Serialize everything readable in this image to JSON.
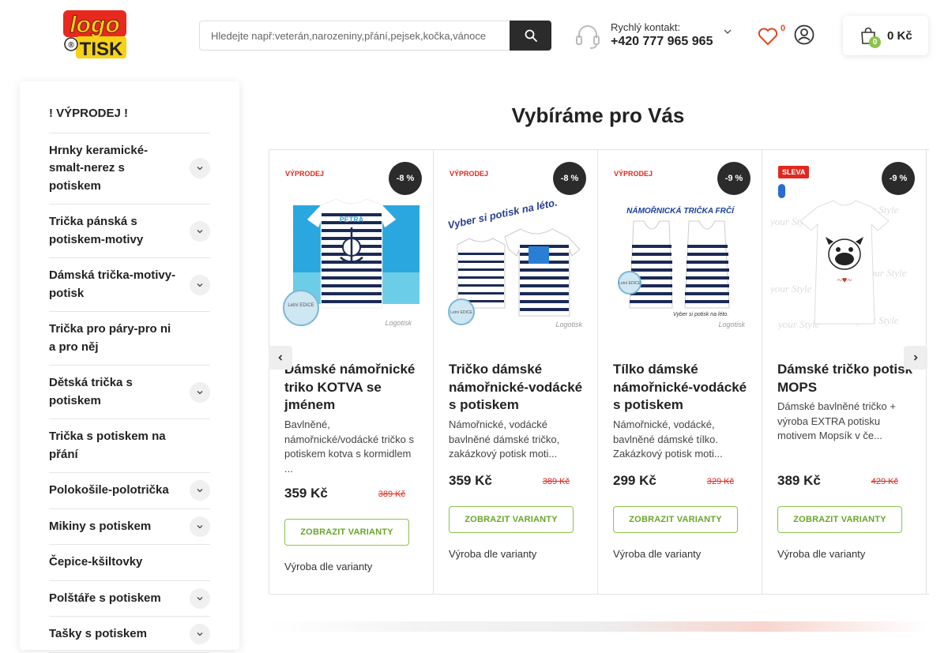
{
  "header": {
    "logo_text_top": "logo",
    "logo_text_bottom": "TISK",
    "search_placeholder": "Hledejte např:veterán,narozeniny,přání,pejsek,kočka,vánoce",
    "contact_label": "Rychlý kontakt:",
    "contact_phone": "+420 777 965 965",
    "wishlist_count": "0",
    "cart_count": "0",
    "cart_total": "0 Kč"
  },
  "sidebar": {
    "items": [
      {
        "label": "! VÝPRODEJ !",
        "expandable": false
      },
      {
        "label": "Hrnky keramické-smalt-nerez s potiskem",
        "expandable": true
      },
      {
        "label": "Trička pánská s potiskem-motivy",
        "expandable": true
      },
      {
        "label": "Dámská trička-motivy-potisk",
        "expandable": true
      },
      {
        "label": "Trička pro páry-pro ni a pro něj",
        "expandable": false
      },
      {
        "label": "Dětská trička s potiskem",
        "expandable": true
      },
      {
        "label": "Trička s potiskem na přání",
        "expandable": false
      },
      {
        "label": "Polokošile-polotrička",
        "expandable": true
      },
      {
        "label": "Mikiny s potiskem",
        "expandable": true
      },
      {
        "label": "Čepice-kšiltovky",
        "expandable": false
      },
      {
        "label": "Polštáře s potiskem",
        "expandable": true
      },
      {
        "label": "Tašky s potiskem",
        "expandable": true
      }
    ]
  },
  "main": {
    "section_title": "Vybíráme pro Vás",
    "products": [
      {
        "badge": "VÝPRODEJ",
        "discount": "-8 %",
        "title": "Dámské námořnické triko KOTVA se jménem",
        "description": "Bavlněné, námořnické/vodácké tričko s potiskem kotva s kormidlem ...",
        "price": "359 Kč",
        "old_price": "389 Kč",
        "button": "ZOBRAZIT VARIANTY",
        "note": "Výroba dle varianty",
        "img_text": "Logotisk",
        "img_name": "PETRA",
        "edition": "Letní EDICE"
      },
      {
        "badge": "VÝPRODEJ",
        "discount": "-8 %",
        "title": "Tričko dámské námořnické-vodácké s potiskem",
        "description": "Námořnické, vodácké bavlněné dámské tričko, zakázkový potisk moti...",
        "price": "359 Kč",
        "old_price": "389 Kč",
        "button": "ZOBRAZIT VARIANTY",
        "note": "Výroba dle varianty",
        "img_text": "Logotisk",
        "img_headline": "Vyber si potisk na léto.",
        "edition": "Letní EDICE"
      },
      {
        "badge": "VÝPRODEJ",
        "discount": "-9 %",
        "title": "Tílko dámské námořnické-vodácké s potiskem",
        "description": "Námořnické, vodácké, bavlněné dámské tílko. Zakázkový potisk moti...",
        "price": "299 Kč",
        "old_price": "329 Kč",
        "button": "ZOBRAZIT VARIANTY",
        "note": "Výroba dle varianty",
        "img_text": "Logotisk",
        "img_headline": "NÁMOŘNICKÁ TRIČKA FRČÍ",
        "img_sub": "Vyber si potisk na léto.",
        "edition": "Letní EDICE"
      },
      {
        "badge": "SLEVA",
        "discount": "-9 %",
        "title": "Dámské tričko potisk MOPS",
        "description": "Dámské bavlněné tričko + výroba EXTRA potisku motivem Mopsík v če...",
        "price": "389 Kč",
        "old_price": "429 Kč",
        "button": "ZOBRAZIT VARIANTY",
        "note": "Výroba dle varianty",
        "img_bg_text": "your Style"
      }
    ]
  },
  "colors": {
    "accent_green": "#8bc34a",
    "sale_red": "#e0281f",
    "dark": "#2b2b2b"
  }
}
